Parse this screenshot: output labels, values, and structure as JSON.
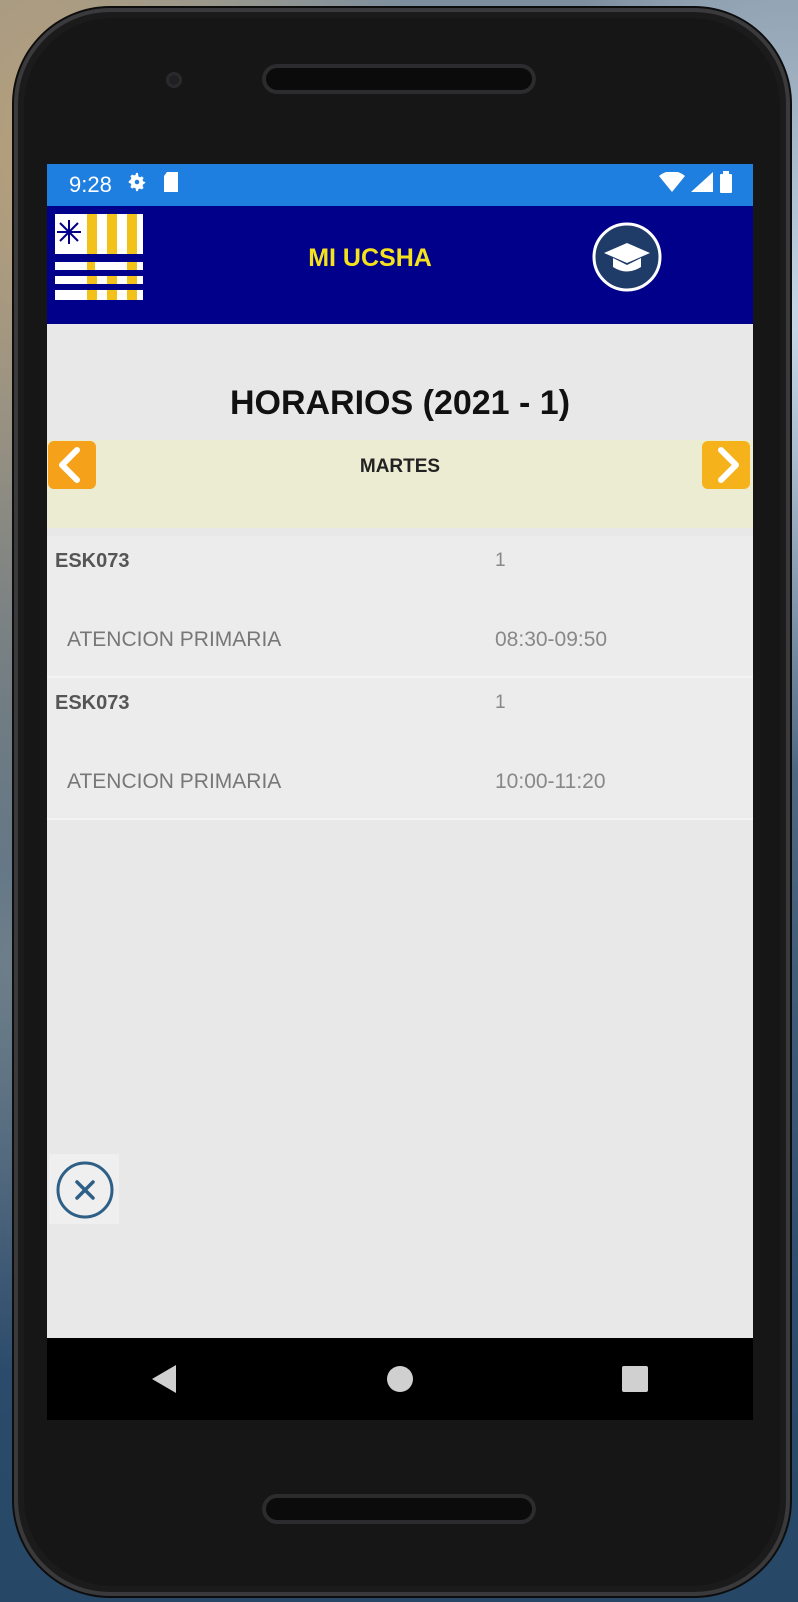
{
  "status_bar": {
    "time": "9:28",
    "icons": [
      "settings-icon",
      "sd-card-icon",
      "wifi-icon",
      "signal-icon",
      "battery-icon"
    ]
  },
  "app_bar": {
    "title": "MI UCSHA",
    "logo_icon": "ucsha-logo",
    "profile_icon": "graduation-cap-icon",
    "colors": {
      "background": "#00008b",
      "title": "#f5e21c"
    }
  },
  "page": {
    "title": "HORARIOS (2021 - 1)",
    "day": "MARTES",
    "prev_icon": "chevron-left-icon",
    "next_icon": "chevron-right-icon"
  },
  "schedule": [
    {
      "code": "ESK073",
      "group": "1",
      "name": "ATENCION PRIMARIA",
      "time": "08:30-09:50"
    },
    {
      "code": "ESK073",
      "group": "1",
      "name": "ATENCION PRIMARIA",
      "time": "10:00-11:20"
    }
  ],
  "close_icon": "close-circle-icon",
  "nav_bar": {
    "icons": [
      "back-icon",
      "home-icon",
      "recents-icon"
    ]
  }
}
